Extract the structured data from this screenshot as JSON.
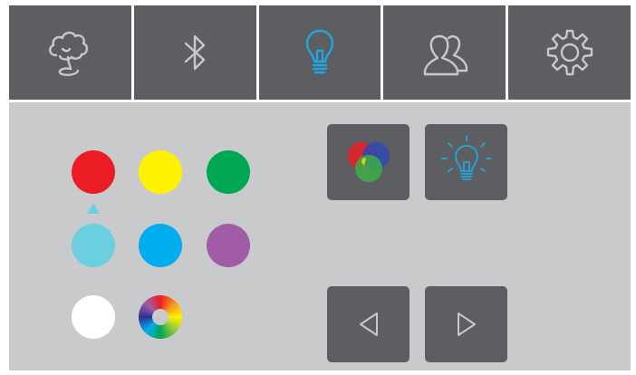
{
  "tabs": [
    {
      "id": "weather",
      "icon": "tree-cloud-icon",
      "active": false
    },
    {
      "id": "bluetooth",
      "icon": "bluetooth-icon",
      "active": false
    },
    {
      "id": "lights",
      "icon": "light-bulb-icon",
      "active": true
    },
    {
      "id": "users",
      "icon": "users-icon",
      "active": false
    },
    {
      "id": "settings",
      "icon": "gear-icon",
      "active": false
    }
  ],
  "colors": {
    "tab_bg": "#5d5e61",
    "tab_icon": "#c8c9cb",
    "active_icon": "#1ea7e1",
    "panel_bg": "#c9cacc",
    "tile_bg": "#5d5e61",
    "tile_icon": "#c8c9cb"
  },
  "swatches": [
    {
      "name": "red",
      "color": "#ec1c24",
      "selected": true
    },
    {
      "name": "yellow",
      "color": "#fff200",
      "selected": false
    },
    {
      "name": "green",
      "color": "#00a651",
      "selected": false
    },
    {
      "name": "light-cyan",
      "color": "#6ccfe0",
      "selected": false
    },
    {
      "name": "blue",
      "color": "#00aeef",
      "selected": false
    },
    {
      "name": "purple",
      "color": "#a05ca7",
      "selected": false
    },
    {
      "name": "white",
      "color": "#ffffff",
      "selected": false
    },
    {
      "name": "spectrum",
      "color": "rainbow",
      "selected": false
    }
  ],
  "mode_buttons": [
    {
      "id": "rgb-mix",
      "icon": "rgb-mix-icon"
    },
    {
      "id": "bright-light",
      "icon": "bright-bulb-icon"
    }
  ],
  "nav_buttons": [
    {
      "id": "previous",
      "icon": "triangle-left-icon"
    },
    {
      "id": "next",
      "icon": "triangle-right-icon"
    }
  ]
}
